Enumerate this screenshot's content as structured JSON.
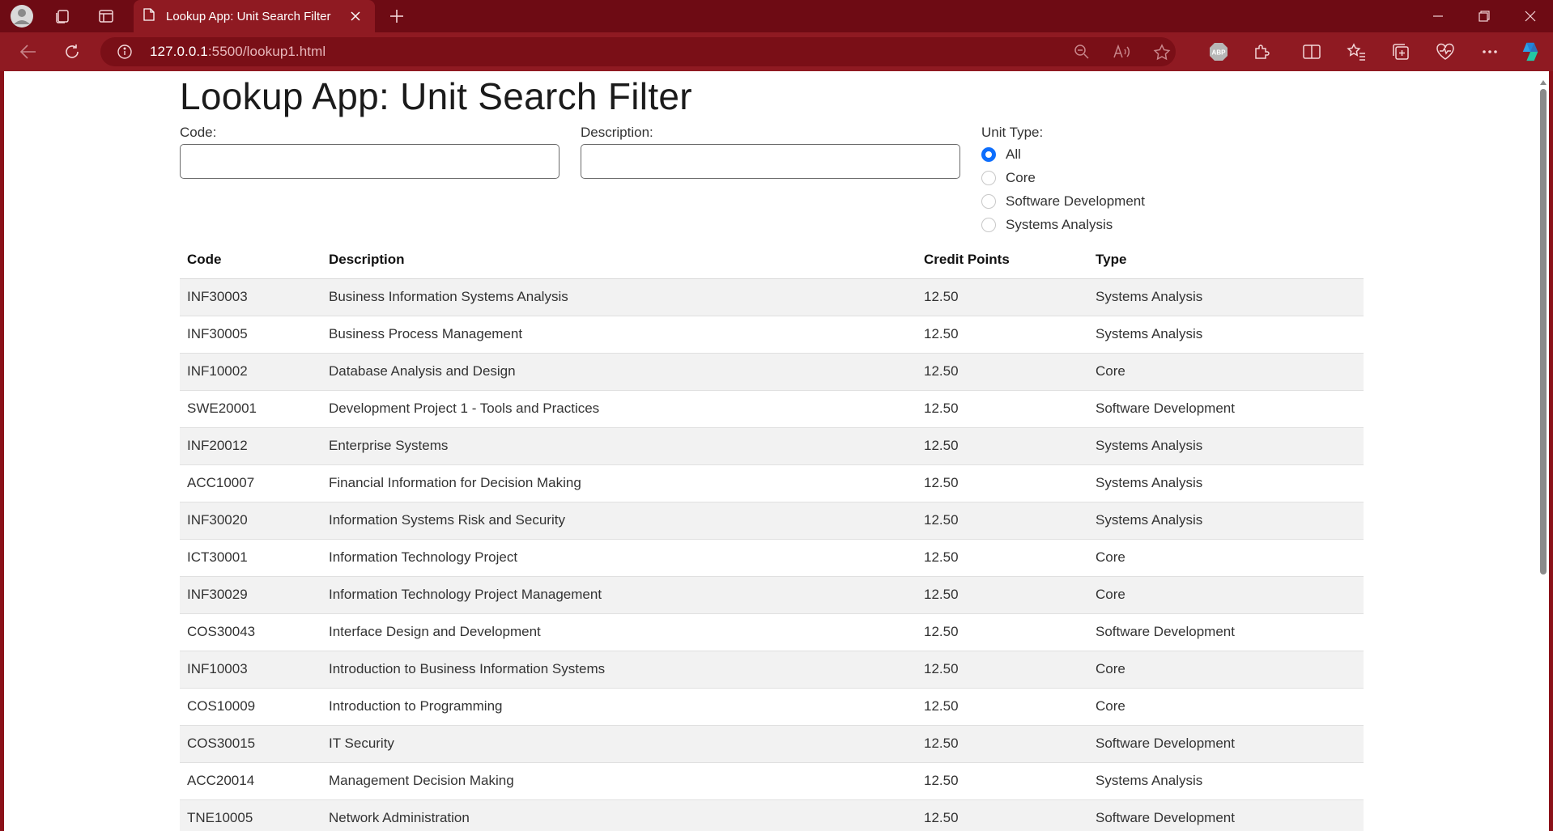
{
  "browser": {
    "tab_title": "Lookup App: Unit Search Filter",
    "url_host": "127.0.0.1",
    "url_rest": ":5500/lookup1.html",
    "accent_color": "#8f1a22"
  },
  "page": {
    "title": "Lookup App: Unit Search Filter",
    "code_label": "Code:",
    "code_value": "",
    "description_label": "Description:",
    "description_value": "",
    "unit_type_label": "Unit Type:",
    "unit_type_options": [
      "All",
      "Core",
      "Software Development",
      "Systems Analysis"
    ],
    "unit_type_selected": "All"
  },
  "table": {
    "headers": [
      "Code",
      "Description",
      "Credit Points",
      "Type"
    ],
    "rows": [
      [
        "INF30003",
        "Business Information Systems Analysis",
        "12.50",
        "Systems Analysis"
      ],
      [
        "INF30005",
        "Business Process Management",
        "12.50",
        "Systems Analysis"
      ],
      [
        "INF10002",
        "Database Analysis and Design",
        "12.50",
        "Core"
      ],
      [
        "SWE20001",
        "Development Project 1 - Tools and Practices",
        "12.50",
        "Software Development"
      ],
      [
        "INF20012",
        "Enterprise Systems",
        "12.50",
        "Systems Analysis"
      ],
      [
        "ACC10007",
        "Financial Information for Decision Making",
        "12.50",
        "Systems Analysis"
      ],
      [
        "INF30020",
        "Information Systems Risk and Security",
        "12.50",
        "Systems Analysis"
      ],
      [
        "ICT30001",
        "Information Technology Project",
        "12.50",
        "Core"
      ],
      [
        "INF30029",
        "Information Technology Project Management",
        "12.50",
        "Core"
      ],
      [
        "COS30043",
        "Interface Design and Development",
        "12.50",
        "Software Development"
      ],
      [
        "INF10003",
        "Introduction to Business Information Systems",
        "12.50",
        "Core"
      ],
      [
        "COS10009",
        "Introduction to Programming",
        "12.50",
        "Core"
      ],
      [
        "COS30015",
        "IT Security",
        "12.50",
        "Software Development"
      ],
      [
        "ACC20014",
        "Management Decision Making",
        "12.50",
        "Systems Analysis"
      ],
      [
        "TNE10005",
        "Network Administration",
        "12.50",
        "Software Development"
      ]
    ]
  }
}
